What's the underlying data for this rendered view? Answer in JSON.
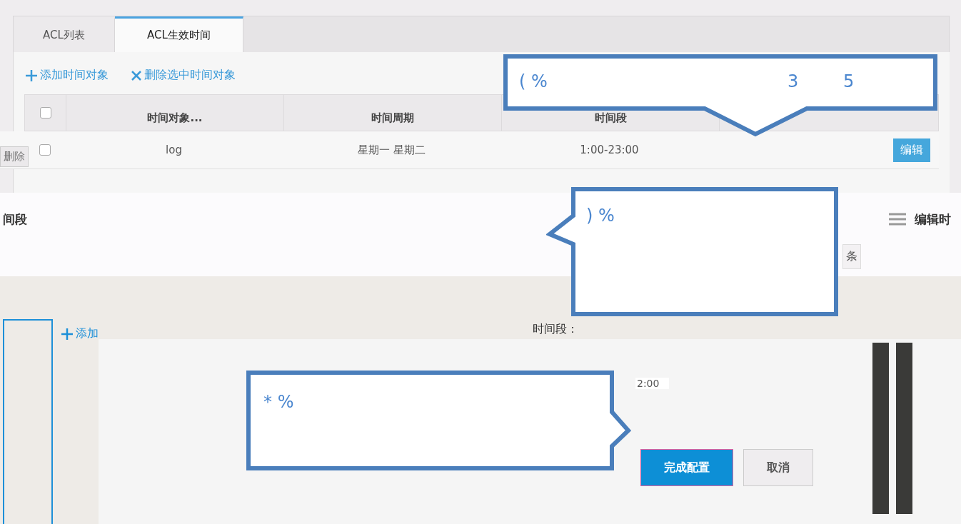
{
  "tabs": [
    {
      "label": "ACL列表",
      "selected": false
    },
    {
      "label": "ACL生效时间",
      "selected": true
    }
  ],
  "toolbar": [
    {
      "kind": "add",
      "label": "添加时间对象"
    },
    {
      "kind": "delete",
      "label": "删除选中时间对象"
    }
  ],
  "side_button": "删除",
  "table": {
    "header_checked": false,
    "columns": [
      "时间对象...",
      "时间周期",
      "时间段"
    ],
    "rows": [
      {
        "checked": false,
        "cells": [
          "log",
          "星期一 星期二",
          "1:00-23:00"
        ],
        "action": "编辑"
      }
    ]
  },
  "dialog": {
    "title": "间段",
    "menu_label": "编辑时",
    "unit": "条",
    "add_label": "添加",
    "field_label": "时间段：",
    "time_value": "2:00",
    "buttons": [
      {
        "label": "完成配置",
        "kind": "primary"
      },
      {
        "label": "取消",
        "kind": "secondary"
      }
    ]
  },
  "callouts": [
    {
      "kind": "down",
      "texts": [
        "( %",
        "3",
        "5"
      ]
    },
    {
      "kind": "left",
      "texts": [
        ") %"
      ]
    },
    {
      "kind": "right",
      "texts": [
        "* %"
      ]
    }
  ]
}
